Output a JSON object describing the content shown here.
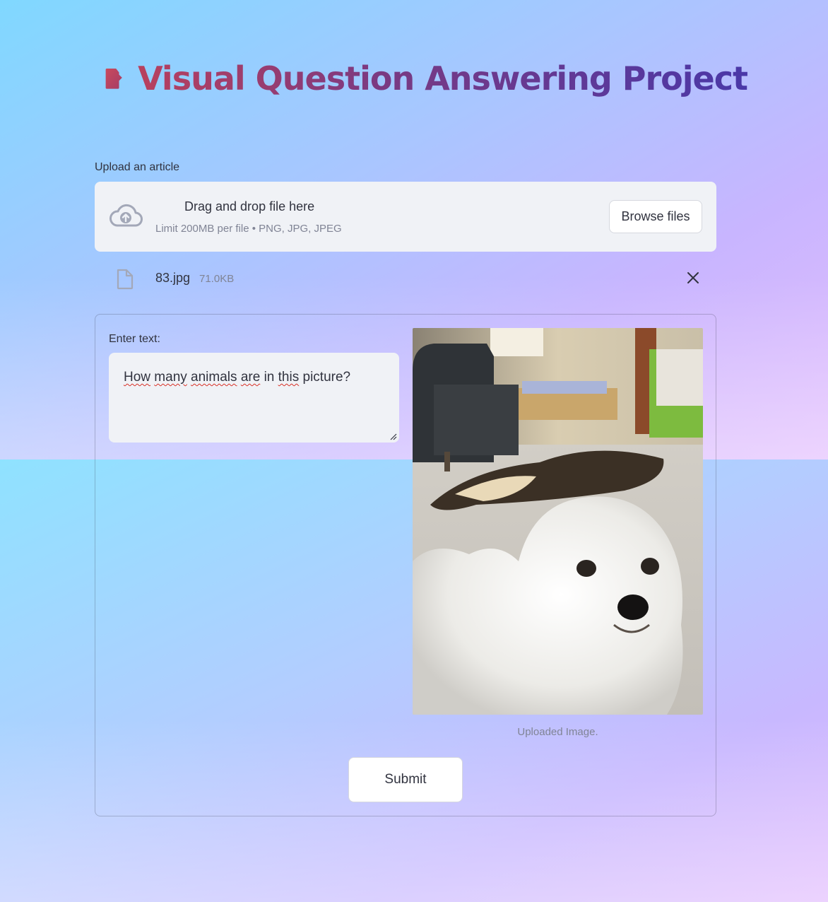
{
  "header": {
    "title": "Visual Question Answering Project",
    "icon": "document-icon",
    "title_gradient": [
      "#b8405e",
      "#4a38a8"
    ]
  },
  "uploader": {
    "label": "Upload an article",
    "drop_text": "Drag and drop file here",
    "limit_text": "Limit 200MB per file • PNG, JPG, JPEG",
    "browse_label": "Browse files",
    "icon": "cloud-upload-icon"
  },
  "uploaded_file": {
    "name": "83.jpg",
    "size": "71.0KB",
    "icon": "file-icon",
    "remove_icon": "close-icon"
  },
  "form": {
    "text_label": "Enter text:",
    "text_value": {
      "w1": "How",
      "w2": "many",
      "w3": "animals",
      "w4": "are",
      "w5": "in",
      "w6": "this",
      "w7": "picture?"
    },
    "image_caption": "Uploaded Image.",
    "submit_label": "Submit"
  },
  "colors": {
    "accent_text": "#31333f",
    "muted_text": "#808495",
    "input_bg": "#f0f2f6",
    "bg_left": "#80d8ff",
    "bg_right": "#e3bdfd"
  }
}
